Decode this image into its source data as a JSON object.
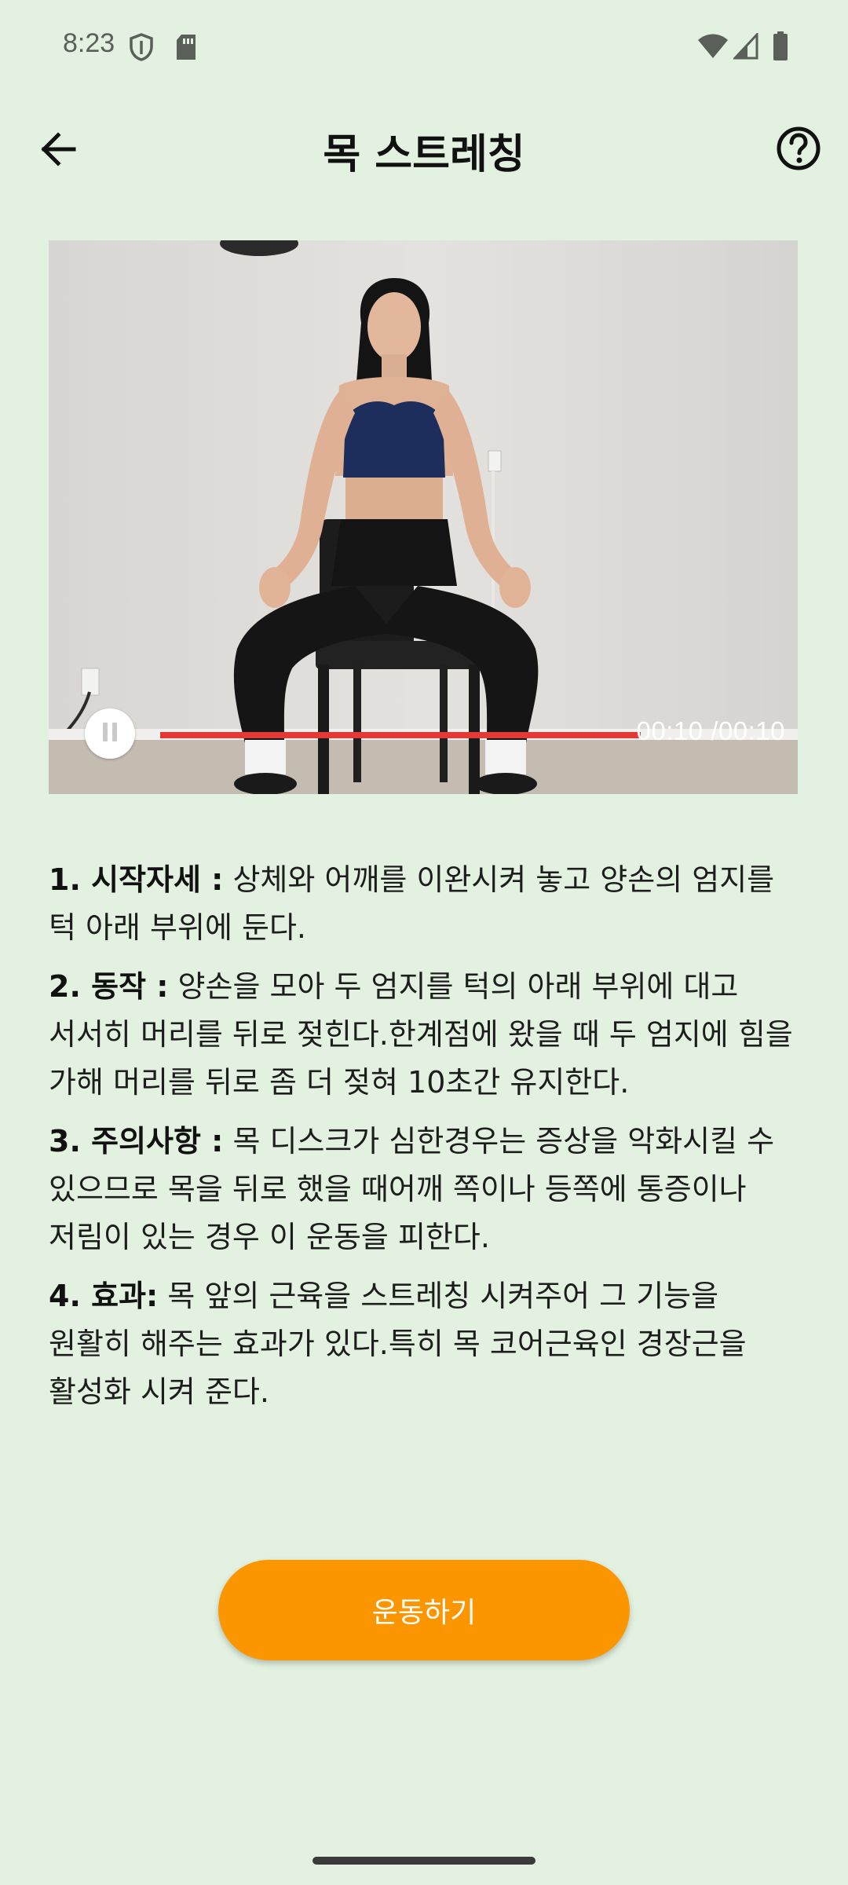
{
  "status_bar": {
    "time": "8:23",
    "icons": [
      "shield-icon",
      "sd-card-icon",
      "wifi-icon",
      "signal-icon",
      "battery-icon"
    ]
  },
  "app_bar": {
    "title": "목 스트레칭",
    "back_icon": "arrow-left-icon",
    "help_icon": "help-circle-icon"
  },
  "video": {
    "progress": 1.0,
    "time_text": "00:10 /00:10",
    "colors": {
      "progress": "#e53935"
    }
  },
  "steps": [
    {
      "label": "1. 시작자세 :",
      "text": " 상체와 어깨를 이완시켜 놓고 양손의 엄지를 턱 아래 부위에 둔다."
    },
    {
      "label": "2. 동작 :",
      "text": " 양손을 모아 두 엄지를 턱의 아래 부위에 대고 서서히 머리를 뒤로 젖힌다.한계점에 왔을 때 두 엄지에 힘을 가해 머리를 뒤로 좀 더 젖혀 10초간 유지한다."
    },
    {
      "label": "3. 주의사항 :",
      "text": " 목 디스크가 심한경우는 증상을 악화시킬 수 있으므로 목을 뒤로 했을 때어깨 쪽이나 등쪽에 통증이나 저림이 있는 경우 이 운동을 피한다."
    },
    {
      "label": "4. 효과:",
      "text": " 목 앞의 근육을 스트레칭 시켜주어 그 기능을 원활히 해주는 효과가 있다.특히 목 코어근육인 경장근을 활성화 시켜 준다."
    }
  ],
  "cta": {
    "label": "운동하기",
    "color": "#fb9600"
  },
  "theme": {
    "background": "#e3f1e1"
  }
}
